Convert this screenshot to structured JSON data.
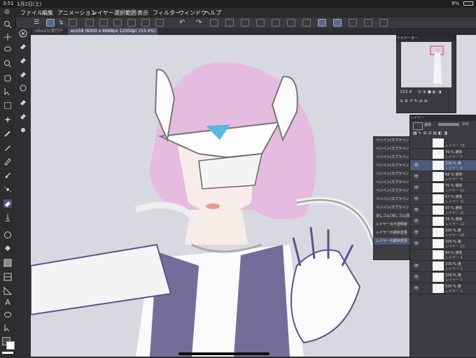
{
  "status": {
    "time": "3:51",
    "date": "1月2日(土)",
    "battery": "9%"
  },
  "menu": [
    "ファイル",
    "編集",
    "アニメーション",
    "レイヤー",
    "選択範囲",
    "表示",
    "フィルター",
    "ウィンドウ",
    "ヘルプ"
  ],
  "tabs": [
    {
      "label": "robo20(実行)*"
    },
    {
      "label": "ens59 (6000 x 6668px 1200dpi 153.4%)"
    }
  ],
  "navigator": {
    "title": "ナビゲーター",
    "zoom": "153.4"
  },
  "layer_panel": {
    "title": "レイヤー",
    "blend": "通常",
    "opacity": "100"
  },
  "layers": [
    {
      "t1": "",
      "t2": "レイヤー 78"
    },
    {
      "t1": "79 % 通常",
      "t2": "レイヤー 7"
    },
    {
      "t1": "100 % 通",
      "t2": "レイヤー 8"
    },
    {
      "t1": "68 % 通常",
      "t2": "レイヤー 9"
    },
    {
      "t1": "75 % 通常",
      "t2": "レイヤー 61"
    },
    {
      "t1": "67 % 通常",
      "t2": "レイヤー 2("
    },
    {
      "t1": "67 % 通常",
      "t2": "レイヤー 2("
    },
    {
      "t1": "74 % 通常",
      "t2": "レイヤー 22"
    },
    {
      "t1": "100 % 通",
      "t2": "レイヤー 24"
    },
    {
      "t1": "100 % 通",
      "t2": "レイヤー 23"
    },
    {
      "t1": "69 % 通常",
      "t2": "レイヤー 4"
    },
    {
      "t1": "100 % 通",
      "t2": "レイヤー 1"
    },
    {
      "t1": "100 % 通",
      "t2": "レイヤー 3"
    },
    {
      "t1": "100 % 通",
      "t2": "レイヤー 1"
    }
  ],
  "history": [
    "ペンペン(カブラペン",
    "ペンペン(カブラペン",
    "ペンペン(カブラペン",
    "ペンペン(カブラペン",
    "ペンペン(カブラペン",
    "ペンペン(カブラペン",
    "ペンペン(カブラペン",
    "ペンペン(カブラペン",
    "ペンペン(カブラペン",
    "消しゴム(消しゴム(硬",
    "レイヤーの不透明度",
    "レイヤーの順序変更",
    "レイヤーの順序変更"
  ],
  "colors": {
    "main": "#4a4a52",
    "sub": "#ffffff"
  }
}
